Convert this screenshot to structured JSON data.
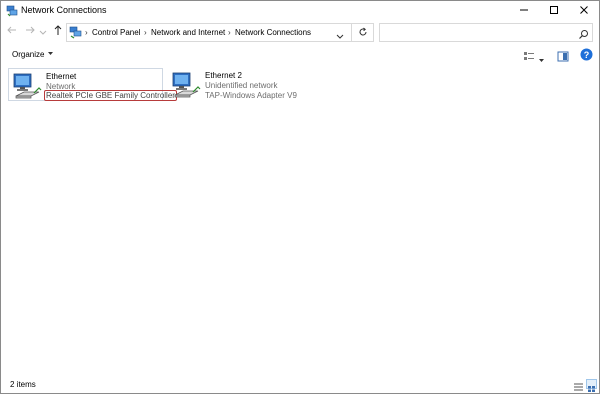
{
  "window": {
    "title": "Network Connections",
    "icons": [
      "network-connections-icon",
      "minimize-icon",
      "maximize-icon",
      "close-icon"
    ]
  },
  "nav": {
    "back_icon": "arrow-left-icon",
    "forward_icon": "arrow-right-icon",
    "recent_icon": "chevron-down-icon",
    "up_icon": "arrow-up-icon"
  },
  "address": {
    "icon": "network-connections-icon",
    "breadcrumbs": [
      "Control Panel",
      "Network and Internet",
      "Network Connections"
    ],
    "separator": "›",
    "dropdown_icon": "chevron-down-icon",
    "refresh_icon": "refresh-icon"
  },
  "search": {
    "value": "",
    "placeholder": "",
    "icon": "search-icon"
  },
  "command_bar": {
    "organize_label": "Organize",
    "organize_icon": "caret-down-icon",
    "change_view_icon": "change-view-icon",
    "preview_pane_icon": "preview-pane-icon",
    "help_icon": "help-icon"
  },
  "items": [
    {
      "name": "Ethernet",
      "status": "Network",
      "device": "Realtek PCIe GBE Family Controller",
      "icon": "ethernet-adapter-icon",
      "selected": true
    },
    {
      "name": "Ethernet 2",
      "status": "Unidentified network",
      "device": "TAP-Windows Adapter V9",
      "icon": "ethernet-adapter-icon",
      "selected": false
    }
  ],
  "status_bar": {
    "item_count": "2 items",
    "details_view_icon": "details-view-icon",
    "tiles_view_icon": "large-icons-view-icon"
  },
  "colors": {
    "focus_border": "#b73b3b",
    "selection_border": "#cfd8e3",
    "secondary_text": "#6d6d6d",
    "help_blue": "#1e6fd9"
  }
}
